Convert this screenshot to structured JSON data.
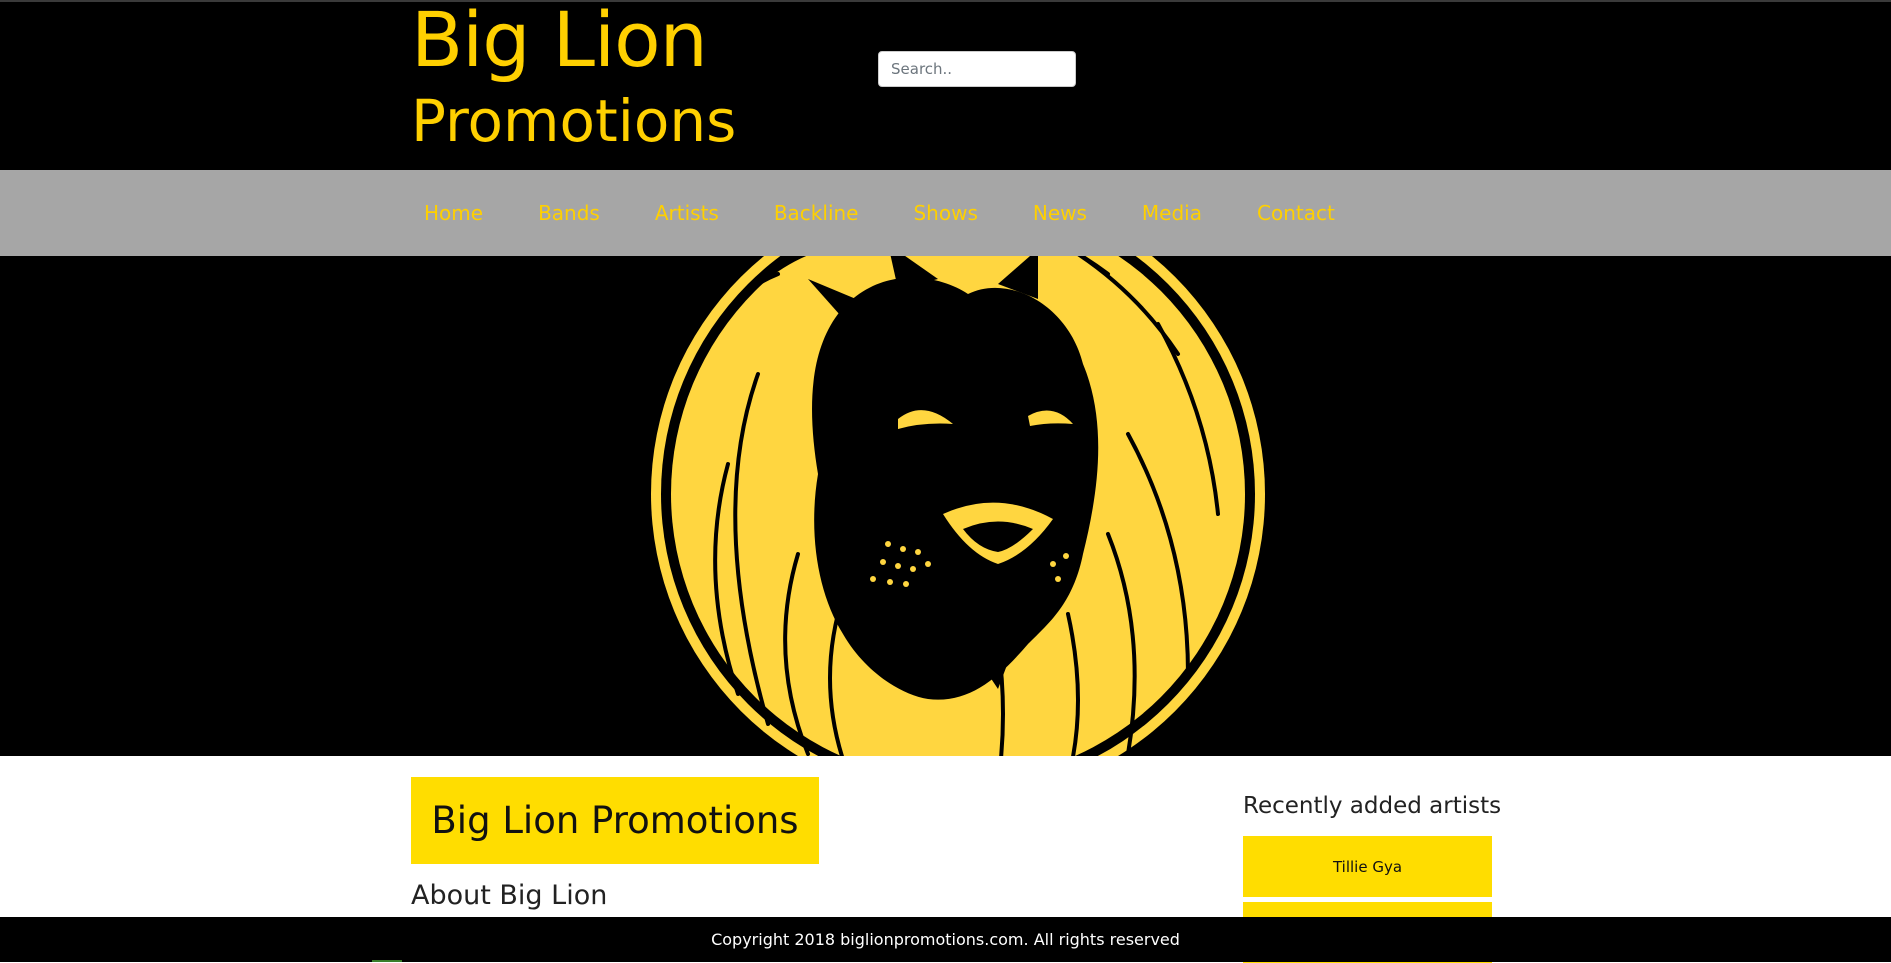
{
  "header": {
    "logo_line1": "Big Lion",
    "logo_line2": "Promotions",
    "search": {
      "placeholder": "Search.."
    }
  },
  "nav": {
    "items": [
      {
        "label": "Home"
      },
      {
        "label": "Bands"
      },
      {
        "label": "Artists"
      },
      {
        "label": "Backline"
      },
      {
        "label": "Shows"
      },
      {
        "label": "News"
      },
      {
        "label": "Media"
      },
      {
        "label": "Contact"
      }
    ]
  },
  "hero": {
    "image": "lion-logo"
  },
  "main": {
    "title": "Big Lion Promotions",
    "about_heading": "About Big Lion"
  },
  "sidebar": {
    "heading": "Recently added artists",
    "artists": [
      {
        "name": "Tillie Gya"
      },
      {
        "name": ""
      }
    ]
  },
  "footer": {
    "copyright": "Copyright 2018 biglionpromotions.com. All rights reserved"
  },
  "colors": {
    "brand_yellow": "#ffd000",
    "box_yellow": "#ffdd00",
    "header_bg": "#000000",
    "nav_bg": "#a6a6a6"
  }
}
